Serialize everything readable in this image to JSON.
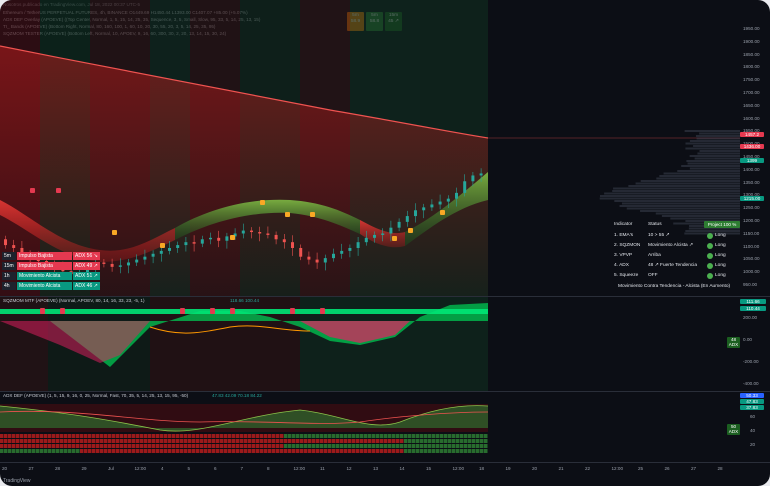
{
  "header": {
    "title_line": "Nosotros publicado en TradingView.com, Jul 18, 2022 00:37 UTC-5",
    "symbol_line": "Ethereum / TetherUS PERPETUAL FUTURES, 4h, BINANCE  O1449.69  H1450.44  L1393.00  C1407.07  +85.00 (+5.07%)",
    "indicator_1": "ADX DEF Overlay (APOEVE) ((Top Center, Normal, 1, 5, 15, 14, 25, 35, Sequence, 3, 5, Small, Slow, 95, 33, 5, 14, 25, 13, 15)",
    "indicator_2": "TI_ Bands (APOEVE) (Bottom Right, Normal, 80, 160, 100, 1, 60, 10, 20, 30, 55, 20, 3, 5, 14, 25, 35, 95)",
    "indicator_3": "SQZMOM TESTER (APOEVE) (Bottom Left, Normal, 10, APOEV, 9, 16, 60, 300, 30, 2, 20, 13, 14, 15, 30, 24)"
  },
  "tf_boxes": [
    {
      "label": "5m",
      "value": "58.9",
      "color": "#f57c00"
    },
    {
      "label": "5m",
      "value": "58.8",
      "color": "#2e7d32"
    },
    {
      "label": "15m",
      "value": "45 ↗",
      "color": "#1b5e20"
    }
  ],
  "mtf_rows": [
    {
      "tf": "5m",
      "status": "Impulso Bajista",
      "adx": "ADX 56 ↘",
      "color": "#e53950"
    },
    {
      "tf": "15m",
      "status": "Impulso Bajista",
      "adx": "ADX 49 ↗",
      "color": "#e53950"
    },
    {
      "tf": "1h",
      "status": "Movimiento Alcista",
      "adx": "ADX 51 ↗",
      "color": "#089981"
    },
    {
      "tf": "4h",
      "status": "Movimiento Alcista",
      "adx": "ADX 46 ↗",
      "color": "#089981"
    }
  ],
  "status_table": {
    "col_indicator": "Indicator",
    "col_status": "Status",
    "projection": "Project 100 %",
    "rows": [
      {
        "indicator": "1. EMA's",
        "status": "10 > 55 ↗",
        "signal": "Long"
      },
      {
        "indicator": "2. SQZMON",
        "status": "Movimiento Alcista ↗",
        "signal": "Long"
      },
      {
        "indicator": "3. VPVP",
        "status": "Arriba",
        "signal": "Long"
      },
      {
        "indicator": "4. ADX",
        "status": "48 ↗ Fuerte Tendencia",
        "signal": "Long"
      },
      {
        "indicator": "5. Squeeze",
        "status": "OFF",
        "signal": "Long"
      }
    ],
    "footer": "Movimiento Contra Tendencia - Alcista (En Aumento)"
  },
  "price_axis": [
    "1950.00",
    "1900.00",
    "1850.00",
    "1800.00",
    "1750.00",
    "1700.00",
    "1650.00",
    "1600.00",
    "1550.00",
    "1500.00",
    "1450.00",
    "1400.00",
    "1350.00",
    "1300.00",
    "1250.00",
    "1200.00",
    "1150.00",
    "1100.00",
    "1050.00",
    "1000.00",
    "950.00"
  ],
  "price_tags": [
    {
      "text": "1457.2",
      "color": "#e53950"
    },
    {
      "text": "1436.00",
      "color": "#e53950"
    },
    {
      "text": "1399",
      "color": "#089981"
    },
    {
      "text": "1215.00",
      "color": "#089981"
    }
  ],
  "pane2": {
    "title": "SQZMOM MTF (APOEVE) (Normal, APOEV, 80, 14, 16, 33, 23, -5, 1)",
    "values": "118.66  100.44",
    "axis": [
      "200.00",
      "0.00",
      "-200.00",
      "-400.00"
    ],
    "tags": [
      "111.66",
      "110.44"
    ],
    "adx_box": "48\nADX"
  },
  "pane3": {
    "title": "ADX DEF (APOEVE) (1, 5, 15, 9, 16, 0, 25, Normal, Fast, 70, 35, 5, 14, 25, 13, 15, 95, -50)",
    "values": "47.83  42.09  70.18  84.22",
    "axis": [
      "60",
      "40",
      "20"
    ],
    "tags": [
      "50.33",
      "47.83",
      "37.83"
    ],
    "adx_box": "50\nADX"
  },
  "time_axis": [
    "20",
    "27",
    "28",
    "29",
    "Jul",
    "12:00",
    "4",
    "5",
    "6",
    "7",
    "8",
    "12:00",
    "11",
    "12",
    "13",
    "14",
    "15",
    "12:00",
    "18",
    "19",
    "20",
    "21",
    "22",
    "12:00",
    "25",
    "26",
    "27",
    "28"
  ],
  "footer": "TradingView",
  "chart_data": {
    "type": "candlestick",
    "title": "Ethereum / TetherUS PERPETUAL FUTURES, 4h, BINANCE",
    "xlabel": "",
    "ylabel": "",
    "ylim": [
      950,
      1950
    ],
    "series": [
      {
        "name": "Close",
        "values": [
          1160,
          1150,
          1130,
          1120,
          1105,
          1095,
          1085,
          1070,
          1060,
          1065,
          1080,
          1100,
          1095,
          1085,
          1090,
          1100,
          1110,
          1120,
          1130,
          1140,
          1150,
          1160,
          1170,
          1165,
          1180,
          1185,
          1175,
          1190,
          1200,
          1210,
          1205,
          1200,
          1195,
          1180,
          1170,
          1150,
          1120,
          1110,
          1100,
          1115,
          1130,
          1140,
          1150,
          1170,
          1185,
          1195,
          1200,
          1220,
          1240,
          1260,
          1280,
          1290,
          1300,
          1310,
          1320,
          1340,
          1380,
          1400,
          1407
        ]
      }
    ]
  }
}
